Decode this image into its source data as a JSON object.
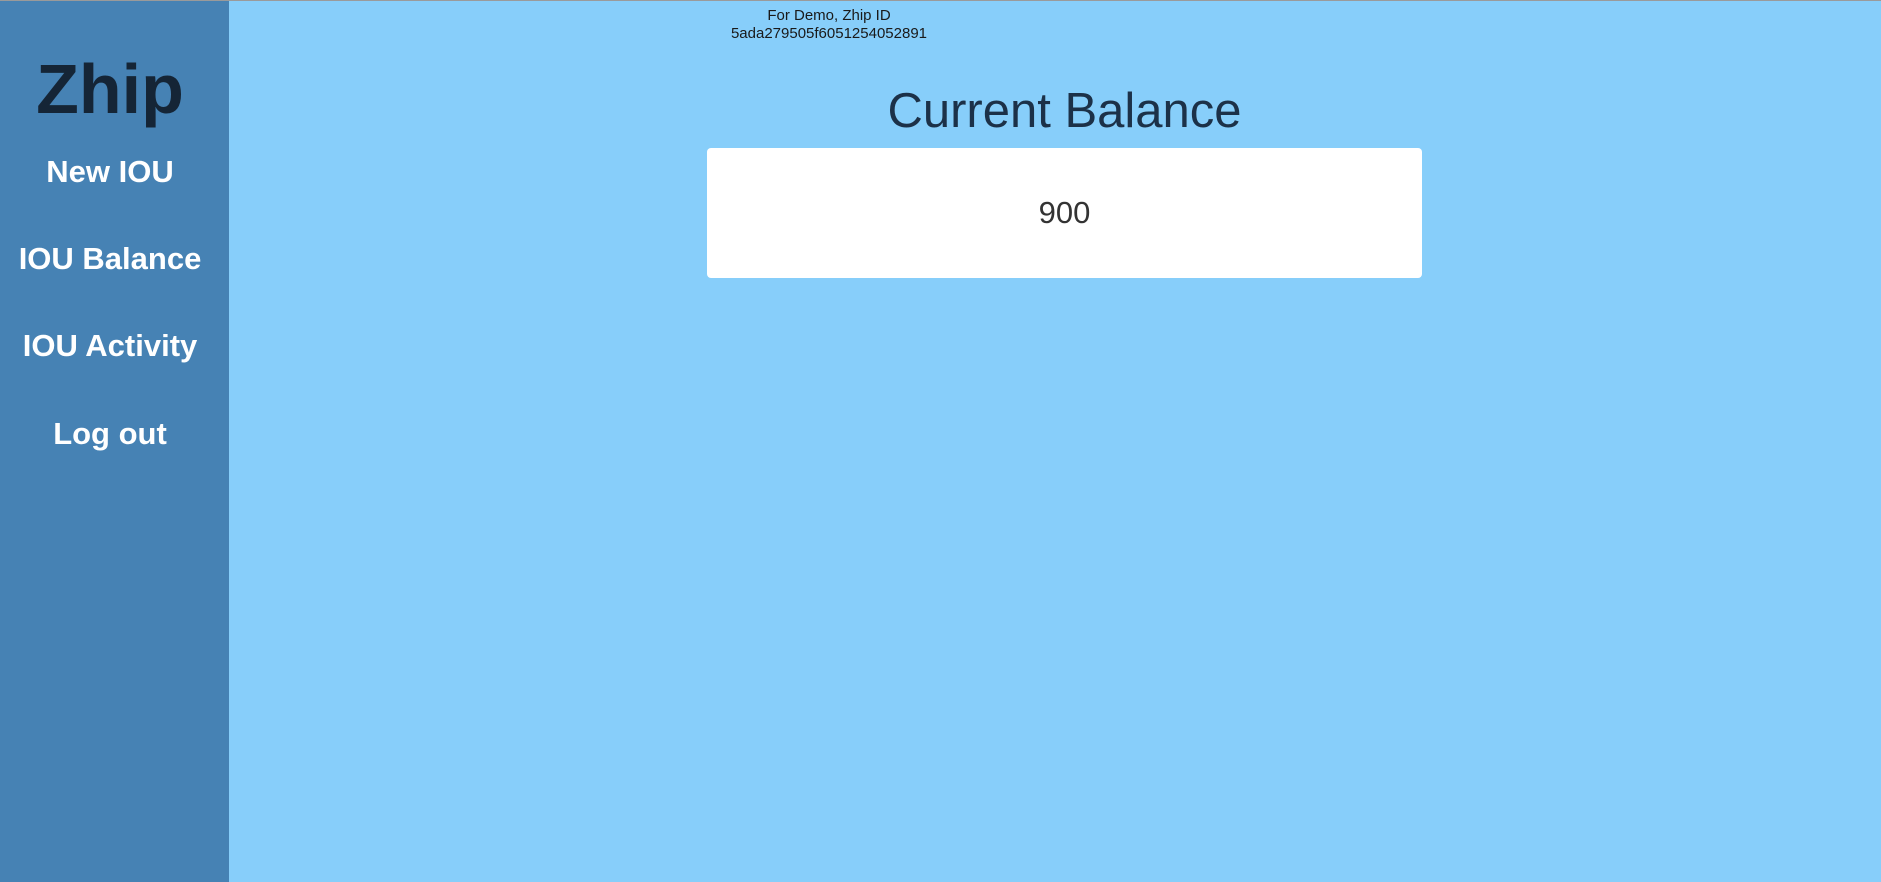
{
  "sidebar": {
    "logo": "Zhip",
    "items": [
      {
        "label": "New IOU"
      },
      {
        "label": "IOU Balance"
      },
      {
        "label": "IOU Activity"
      },
      {
        "label": "Log out"
      }
    ]
  },
  "demo": {
    "line1": "For Demo, Zhip ID",
    "line2": "5ada279505f6051254052891"
  },
  "main": {
    "title": "Current Balance",
    "balance": "900"
  },
  "colors": {
    "sidebar_bg": "#4682b4",
    "main_bg": "#87cefa",
    "card_bg": "#ffffff",
    "logo_text": "#152536"
  }
}
